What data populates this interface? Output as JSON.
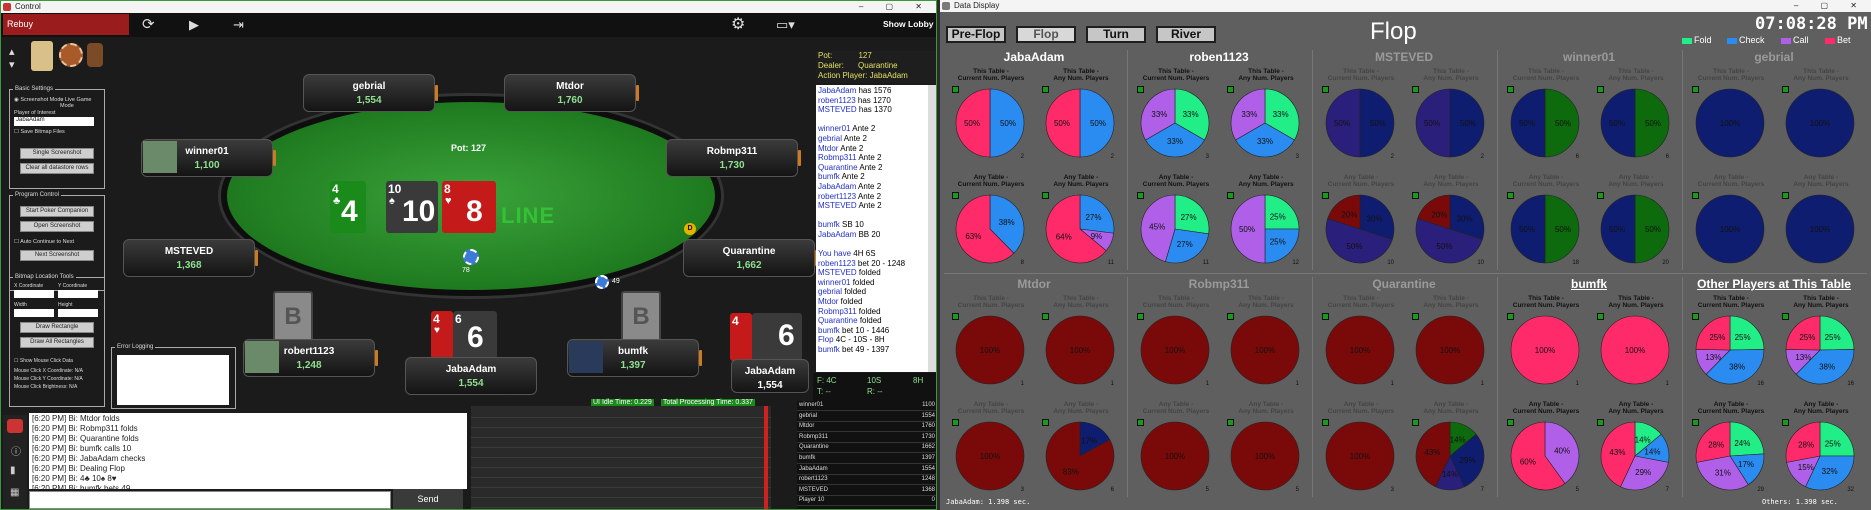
{
  "control": {
    "title": "Control",
    "rebuy": "Rebuy",
    "show_lobby": "Show Lobby",
    "pot": "Pot: 127",
    "line_text": "LINE",
    "main_pot": "78",
    "side_chip": "49",
    "board": [
      {
        "rank": "4",
        "suit": "♣",
        "color": "#1a8a1a"
      },
      {
        "rank": "10",
        "suit": "♠",
        "color": "#3a3a3a"
      },
      {
        "rank": "8",
        "suit": "♥",
        "color": "#c41a1a"
      }
    ],
    "hero_cards": [
      {
        "rank": "4",
        "suit": "♥",
        "color": "#c41a1a"
      },
      {
        "rank": "6",
        "suit": "♠",
        "color": "#3a3a3a"
      }
    ],
    "seats": [
      {
        "name": "gebrial",
        "stack": "1,554"
      },
      {
        "name": "Mtdor",
        "stack": "1,760"
      },
      {
        "name": "winner01",
        "stack": "1,100"
      },
      {
        "name": "Robmp311",
        "stack": "1,730"
      },
      {
        "name": "MSTEVED",
        "stack": "1,368"
      },
      {
        "name": "Quarantine",
        "stack": "1,662"
      },
      {
        "name": "robert1123",
        "stack": "1,248"
      },
      {
        "name": "bumfk",
        "stack": "1,397"
      },
      {
        "name": "JabaAdam",
        "stack": "1,554"
      },
      {
        "name": "JabaAdam",
        "stack": "1,554"
      }
    ],
    "sidebar": {
      "basic_settings": "Basic Settings",
      "screenshot_mode": "Screenshot Mode",
      "live_game_mode": "Live Game Mode",
      "player_of_interest": "Player of Interest",
      "player_value": "JabaAdam",
      "save_bitmap": "Save Bitmap Files",
      "btn1": "Single Screenshot",
      "btn2": "Clear all datastore rows",
      "program_control": "Program Control",
      "start_btn": "Start Poker Companion",
      "open_ss": "Open Screenshot",
      "auto_continue": "Auto Continue to Next",
      "next_ss": "Next Screenshot",
      "bitmap_tools": "Bitmap Location Tools",
      "xcoord": "X Coordinate",
      "ycoord": "Y Coordinate",
      "width": "Width",
      "height": "Height",
      "draw_rect": "Draw Rectangle",
      "draw_all": "Draw All Rectangles",
      "show_mouse": "Show Mouse Click Data",
      "mx": "Mouse Click X Coordinate: N/A",
      "my": "Mouse Click Y Coordinate: N/A",
      "mb": "Mouse Click Brightness: N/A",
      "error_logging": "Error Logging"
    },
    "info": {
      "pot_label": "Pot:",
      "pot_val": "127",
      "dealer_label": "Dealer:",
      "dealer_val": "Quarantine",
      "action_label": "Action Player:",
      "action_val": "JabaAdam"
    },
    "log_right": [
      [
        "JabaAdam",
        " has 1576"
      ],
      [
        "roben1123",
        " has 1270"
      ],
      [
        "MSTEVED",
        " has 1370"
      ],
      [
        "",
        ""
      ],
      [
        "winner01",
        " Ante 2"
      ],
      [
        "gebrial",
        " Ante 2"
      ],
      [
        "Mtdor",
        " Ante 2"
      ],
      [
        "Robmp311",
        " Ante 2"
      ],
      [
        "Quarantine",
        " Ante 2"
      ],
      [
        "bumfk",
        " Ante 2"
      ],
      [
        "JabaAdam",
        " Ante 2"
      ],
      [
        "robert1123",
        " Ante 2"
      ],
      [
        "MSTEVED",
        " Ante 2"
      ],
      [
        "",
        ""
      ],
      [
        "bumfk",
        " SB 10"
      ],
      [
        "JabaAdam",
        " BB 20"
      ],
      [
        "",
        ""
      ],
      [
        "You have",
        " 4H 6S"
      ],
      [
        "roben1123",
        " bet 20 - 1248"
      ],
      [
        "MSTEVED",
        " folded"
      ],
      [
        "winner01",
        " folded"
      ],
      [
        "gebrial",
        " folded"
      ],
      [
        "Mtdor",
        " folded"
      ],
      [
        "Robmp311",
        " folded"
      ],
      [
        "Quarantine",
        " folded"
      ],
      [
        "bumfk",
        " bet 10 - 1446"
      ],
      [
        "Flop",
        " 4C - 10S - 8H"
      ],
      [
        "bumfk",
        " bet 49 - 1397"
      ]
    ],
    "board_readout": [
      "F: 4C",
      "T: --",
      "10S",
      "R: --",
      "8H"
    ],
    "ui_idle": "UI Idle Time: 0.229",
    "total_proc": "Total Processing Time: 0.337",
    "chat": [
      "[6:20 PM] Bi: Mtdor folds",
      "[6:20 PM] Bi: Robmp311 folds",
      "[6:20 PM] Bi: Quarantine folds",
      "[6:20 PM] Bi: bumfk calls 10",
      "[6:20 PM] Bi: JabaAdam checks",
      "[6:20 PM] Bi: Dealing Flop",
      "[6:20 PM] Bi: 4♣ 10♠ 8♥",
      "[6:20 PM] Bi: bumfk bets 49"
    ],
    "send": "Send",
    "players_table": [
      [
        "winner01",
        "1100"
      ],
      [
        "gebrial",
        "1554"
      ],
      [
        "Mtdor",
        "1760"
      ],
      [
        "Robmp311",
        "1730"
      ],
      [
        "Quarantine",
        "1662"
      ],
      [
        "bumfk",
        "1397"
      ],
      [
        "JabaAdam",
        "1554"
      ],
      [
        "robert1123",
        "1248"
      ],
      [
        "MSTEVED",
        "1368"
      ],
      [
        "Player 10",
        "0"
      ]
    ]
  },
  "display": {
    "title": "Data Display",
    "tabs": [
      "Pre-Flop",
      "Flop",
      "Turn",
      "River"
    ],
    "heading": "Flop",
    "clock": "07:08:28 PM",
    "legend": [
      {
        "label": "Fold",
        "color": "#22ee88"
      },
      {
        "label": "Check",
        "color": "#2a8cf0"
      },
      {
        "label": "Call",
        "color": "#b060e8"
      },
      {
        "label": "Bet",
        "color": "#ff2a6a"
      }
    ],
    "labels": {
      "tc": "This Table -\nCurrent Num. Players",
      "ta": "This Table -\nAny Num. Players",
      "ac": "Any Table -\nCurrent Num. Players",
      "aa": "Any Table -\nAny Num. Players"
    },
    "players": [
      {
        "name": "JabaAdam",
        "active": true,
        "pies": [
          [
            [
              0,
              0,
              0,
              50,
              "#ff2a6a"
            ],
            [
              0,
              50,
              0,
              0,
              "#2a8cf0"
            ]
          ],
          [
            [
              0,
              0,
              0,
              50,
              "#ff2a6a"
            ],
            [
              0,
              50,
              0,
              0,
              "#2a8cf0"
            ]
          ],
          [
            [
              0,
              38,
              0,
              63,
              "#ff2a6a"
            ]
          ],
          [
            [
              0,
              27,
              9,
              64,
              "#ff2a6a"
            ]
          ]
        ],
        "counts": [
          "2",
          "2",
          "8",
          "11"
        ],
        "labels": [
          [
            "50%",
            "50%"
          ],
          [
            "50%",
            "50%"
          ],
          [
            "38%",
            "63%"
          ],
          [
            "27%",
            "9%",
            "64%"
          ]
        ]
      },
      {
        "name": "roben1123",
        "active": true,
        "pies": [
          [
            [
              33,
              33,
              33,
              0
            ]
          ],
          [
            [
              33,
              33,
              33,
              0
            ]
          ],
          [
            [
              45,
              27,
              27,
              0
            ]
          ],
          [
            [
              50,
              25,
              25,
              0
            ]
          ]
        ],
        "counts": [
          "3",
          "3",
          "11",
          "12"
        ],
        "labels": [
          [
            "33%",
            "33%",
            "33%"
          ],
          [
            "33%",
            "33%",
            "33%"
          ],
          [
            "45%",
            "27%",
            "27%"
          ],
          [
            "50%",
            "25%",
            "25%"
          ]
        ]
      },
      {
        "name": "MSTEVED",
        "active": false,
        "pies": [
          [
            [
              50,
              50,
              "dk"
            ]
          ],
          [
            [
              50,
              50,
              "dk"
            ]
          ],
          [
            [
              20,
              30,
              50,
              "dk3"
            ]
          ],
          [
            [
              20,
              30,
              50,
              "dk3"
            ]
          ]
        ],
        "counts": [
          "2",
          "2",
          "10",
          "10"
        ],
        "labels": [
          [
            "50%",
            "50%"
          ],
          [
            "50%",
            "50%"
          ],
          [
            "20%",
            "30%",
            "50%"
          ],
          [
            "20%",
            "30%",
            "50%"
          ]
        ]
      },
      {
        "name": "winner01",
        "active": false,
        "pies": [
          [
            [
              50,
              50,
              "dg"
            ]
          ],
          [
            [
              50,
              50,
              "dg"
            ]
          ],
          [
            [
              50,
              50,
              "dg"
            ]
          ],
          [
            [
              50,
              50,
              "dg"
            ]
          ]
        ],
        "counts": [
          "6",
          "6",
          "18",
          "20"
        ],
        "labels": [
          [
            "50%",
            "50%"
          ],
          [
            "50%",
            "50%"
          ],
          [
            "50%",
            "50%"
          ],
          [
            "50%",
            "50%"
          ]
        ]
      },
      {
        "name": "gebrial",
        "active": false,
        "pies": [
          [
            [
              100,
              "dk1"
            ]
          ],
          [
            [
              100,
              "dk1"
            ]
          ],
          [
            [
              100,
              "dk1"
            ]
          ],
          [
            [
              100,
              "dk1"
            ]
          ]
        ],
        "counts": [
          "",
          "",
          "",
          ""
        ],
        "labels": [
          [
            "100%"
          ],
          [
            "100%"
          ],
          [
            "100%"
          ],
          [
            "100%"
          ]
        ]
      },
      {
        "name": "Mtdor",
        "active": false,
        "pies": [
          [
            [
              100,
              "dr"
            ]
          ],
          [
            [
              100,
              "dr"
            ]
          ],
          [
            [
              100,
              "dr"
            ]
          ],
          [
            [
              83,
              17,
              "dr2"
            ]
          ]
        ],
        "counts": [
          "1",
          "1",
          "3",
          "6"
        ],
        "labels": [
          [
            "100%"
          ],
          [
            "100%"
          ],
          [
            "100%"
          ],
          [
            "83%",
            "17%"
          ]
        ]
      },
      {
        "name": "Robmp311",
        "active": false,
        "pies": [
          [
            [
              100,
              "dr"
            ]
          ],
          [
            [
              100,
              "dr"
            ]
          ],
          [
            [
              100,
              "dr"
            ]
          ],
          [
            [
              100,
              "dr"
            ]
          ]
        ],
        "counts": [
          "1",
          "1",
          "5",
          "5"
        ],
        "labels": [
          [
            "100%"
          ],
          [
            "100%"
          ],
          [
            "100%"
          ],
          [
            "100%"
          ]
        ]
      },
      {
        "name": "Quarantine",
        "active": false,
        "pies": [
          [
            [
              100,
              "dr"
            ]
          ],
          [
            [
              100,
              "dr"
            ]
          ],
          [
            [
              100,
              "dr"
            ]
          ],
          [
            [
              43,
              14,
              29,
              14,
              "dr4"
            ]
          ]
        ],
        "counts": [
          "1",
          "1",
          "3",
          "7"
        ],
        "labels": [
          [
            "100%"
          ],
          [
            "100%"
          ],
          [
            "100%"
          ],
          [
            "43%",
            "14%",
            "29%",
            "14%"
          ]
        ]
      },
      {
        "name": "bumfk",
        "active": true,
        "pies": [
          [
            [
              100,
              "pk"
            ]
          ],
          [
            [
              100,
              "pk"
            ]
          ],
          [
            [
              60,
              40,
              "pp"
            ]
          ],
          [
            [
              43,
              14,
              29,
              14,
              "mix"
            ]
          ]
        ],
        "counts": [
          "1",
          "1",
          "5",
          "7"
        ],
        "labels": [
          [
            "100%"
          ],
          [
            "100%"
          ],
          [
            "60%",
            "40%"
          ],
          [
            "43%",
            "14%",
            "29%",
            "14%"
          ]
        ]
      },
      {
        "name": "Other Players at This Table",
        "active": true,
        "pies": [
          [
            [
              25,
              38,
              13,
              25,
              "o"
            ]
          ],
          [
            [
              25,
              38,
              13,
              25,
              "o"
            ]
          ],
          [
            [
              24,
              17,
              31,
              28,
              "o"
            ]
          ],
          [
            [
              25,
              32,
              15,
              28,
              "o"
            ]
          ]
        ],
        "counts": [
          "16",
          "16",
          "29",
          "32"
        ],
        "labels": [
          [
            "25%",
            "38%",
            "13%",
            "25%"
          ],
          [
            "25%",
            "38%",
            "13%",
            "25%"
          ],
          [
            "24%",
            "17%",
            "31%",
            "28%"
          ],
          [
            "25%",
            "32%",
            "15%",
            "28%"
          ]
        ]
      }
    ],
    "footer_left": "JabaAdam: 1.398 sec.",
    "footer_right": "Others: 1.398 sec."
  }
}
